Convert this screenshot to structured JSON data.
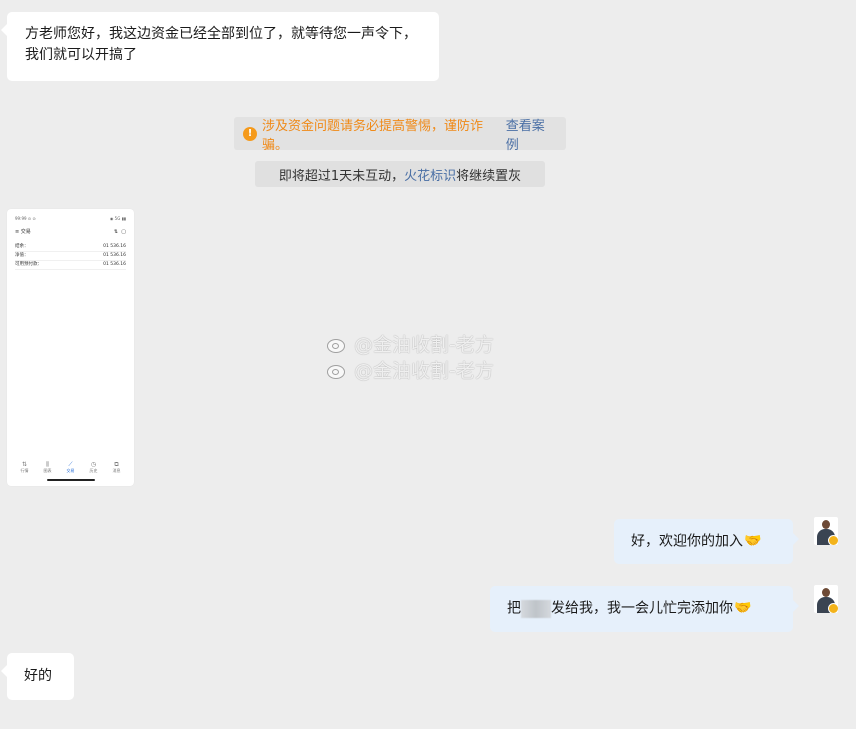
{
  "messages": {
    "incoming_1": "方老师您好，我这边资金已经全部到位了，就等待您一声令下，我们就可以开搞了",
    "warning_text": "涉及资金问题请务必提高警惕，谨防诈骗。",
    "warning_link": "查看案例",
    "grey_prefix": "即将超过1天未互动，",
    "grey_link": "火花标识",
    "grey_suffix": "将继续置灰",
    "outgoing_1": "好，欢迎你的加入",
    "outgoing_2_prefix": "把",
    "outgoing_2_suffix": "发给我，我一会儿忙完添加你",
    "incoming_2": "好的"
  },
  "watermark": "@金油收割-老方",
  "phone": {
    "status_left": "99:99 ⊙ ⊙",
    "status_right": "◉ 5G ▮▮",
    "title": "交易",
    "rows": [
      {
        "label": "结余：",
        "value": "01 536.16"
      },
      {
        "label": "净值：",
        "value": "01 536.16"
      },
      {
        "label": "可用预付款：",
        "value": "01 536.16"
      }
    ],
    "nav": [
      "行情",
      "图表",
      "交易",
      "历史",
      "消息"
    ]
  },
  "icons": {
    "warning": "info-icon",
    "emoji": "handshake-emoji",
    "avatar": "user-avatar"
  },
  "colors": {
    "accent_link": "#4a6fa5",
    "warning": "#f08a18",
    "outgoing_bubble": "#e6f0fb"
  }
}
